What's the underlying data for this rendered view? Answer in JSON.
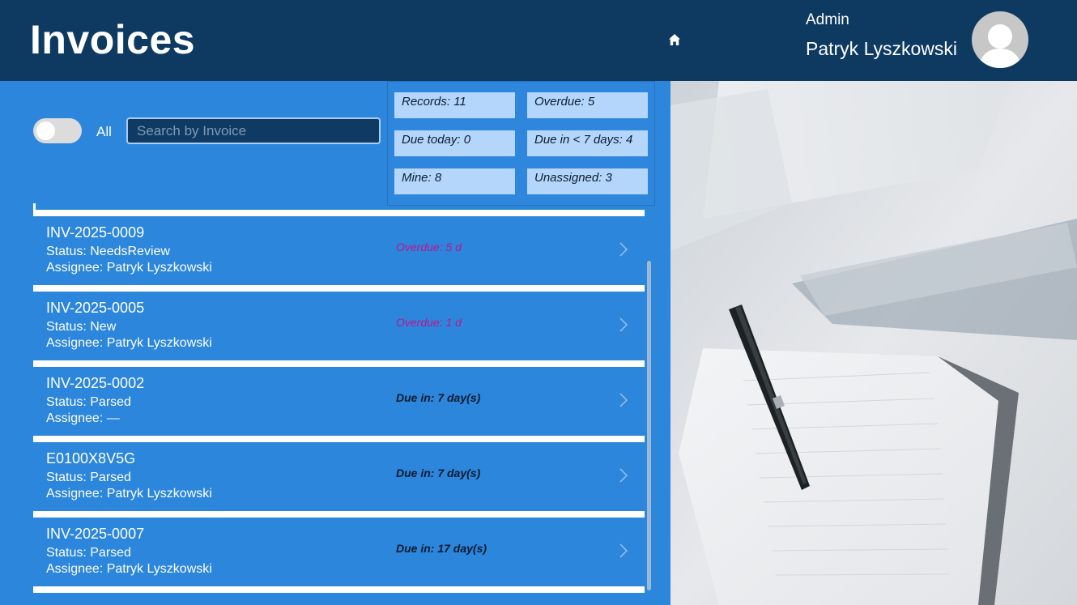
{
  "header": {
    "title": "Invoices",
    "user_role": "Admin",
    "user_name": "Patryk Lyszkowski"
  },
  "filter": {
    "toggle_label": "All",
    "toggle_on": false,
    "search_placeholder": "Search by Invoice",
    "search_value": ""
  },
  "stats": [
    {
      "label": "Records: 11"
    },
    {
      "label": "Overdue: 5"
    },
    {
      "label": "Due today: 0"
    },
    {
      "label": "Due in < 7 days: 4"
    },
    {
      "label": "Mine: 8"
    },
    {
      "label": "Unassigned: 3"
    }
  ],
  "invoices": [
    {
      "id": "INV-2025-0009",
      "status": "Status: NeedsReview",
      "assignee": "Assignee: Patryk Lyszkowski",
      "due": "Overdue: 5 d",
      "overdue": true
    },
    {
      "id": "INV-2025-0005",
      "status": "Status: New",
      "assignee": "Assignee: Patryk Lyszkowski",
      "due": "Overdue: 1 d",
      "overdue": true
    },
    {
      "id": "INV-2025-0002",
      "status": "Status: Parsed",
      "assignee": "Assignee: —",
      "due": "Due in: 7 day(s)",
      "overdue": false
    },
    {
      "id": "E0100X8V5G",
      "status": "Status: Parsed",
      "assignee": "Assignee: Patryk Lyszkowski",
      "due": "Due in: 7 day(s)",
      "overdue": false
    },
    {
      "id": "INV-2025-0007",
      "status": "Status: Parsed",
      "assignee": "Assignee: Patryk Lyszkowski",
      "due": "Due in: 17 day(s)",
      "overdue": false
    }
  ],
  "icons": {
    "home": "home-icon",
    "avatar": "user-avatar-icon",
    "chevron": "chevron-right-icon"
  },
  "colors": {
    "header_bg": "#0e3a61",
    "panel_bg": "#2b86dc",
    "stat_bg": "#b3d6fa",
    "overdue_text": "#c2148b"
  }
}
